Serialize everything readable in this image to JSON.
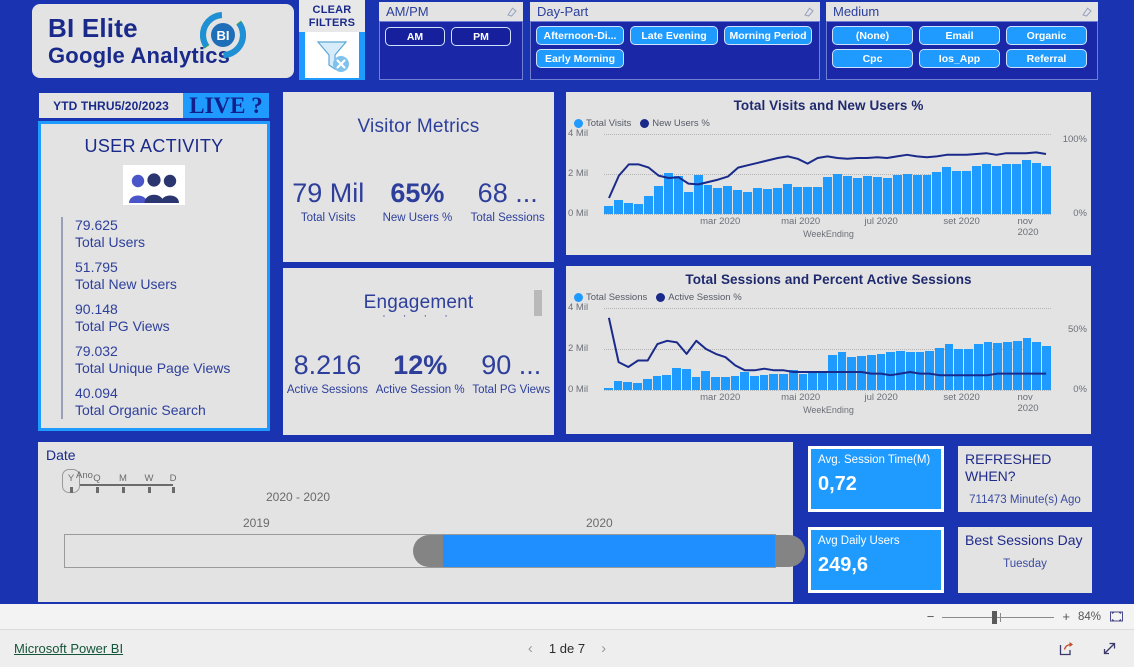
{
  "brand": {
    "line1": "BI Elite",
    "line2": "Google Analytics",
    "logo_text": "BI"
  },
  "header": {
    "clear_filters": {
      "line1": "CLEAR",
      "line2": "FILTERS",
      "icon": "funnel-clear-icon"
    },
    "slicers": [
      {
        "title": "AM/PM",
        "eraser_icon": "eraser-icon",
        "chips": [
          {
            "label": "AM",
            "style": "dark"
          },
          {
            "label": "PM",
            "style": "dark"
          }
        ]
      },
      {
        "title": "Day-Part",
        "eraser_icon": "eraser-icon",
        "chips": [
          {
            "label": "Afternoon-Di...",
            "style": "light"
          },
          {
            "label": "Late Evening",
            "style": "light"
          },
          {
            "label": "Morning Period",
            "style": "light"
          },
          {
            "label": "Early Morning",
            "style": "light"
          }
        ]
      },
      {
        "title": "Medium",
        "eraser_icon": "eraser-icon",
        "chips": [
          {
            "label": "(None)",
            "style": "light"
          },
          {
            "label": "Email",
            "style": "light"
          },
          {
            "label": "Organic",
            "style": "light"
          },
          {
            "label": "Cpc",
            "style": "light"
          },
          {
            "label": "Ios_App",
            "style": "light"
          },
          {
            "label": "Referral",
            "style": "light"
          }
        ]
      }
    ]
  },
  "ytd": {
    "label": "YTD THRU5/20/2023",
    "live": "LIVE ?"
  },
  "user_activity": {
    "title": "USER ACTIVITY",
    "icon": "people-group-icon",
    "metrics": [
      {
        "value": "79.625",
        "label": "Total Users"
      },
      {
        "value": "51.795",
        "label": "Total New Users"
      },
      {
        "value": "90.148",
        "label": "Total PG Views"
      },
      {
        "value": "79.032",
        "label": "Total Unique Page Views"
      },
      {
        "value": "40.094",
        "label": "Total Organic Search"
      }
    ]
  },
  "visitor_metrics": {
    "title": "Visitor Metrics",
    "items": [
      {
        "value": "79 Mil",
        "label": "Total Visits",
        "bold": false
      },
      {
        "value": "65%",
        "label": "New Users %",
        "bold": true
      },
      {
        "value": "68 ...",
        "label": "Total Sessions",
        "bold": false
      }
    ]
  },
  "engagement": {
    "title": "Engagement",
    "dots": "· · · ·",
    "items": [
      {
        "value": "8.216",
        "label": "Active Sessions",
        "bold": false
      },
      {
        "value": "12%",
        "label": "Active Session %",
        "bold": true
      },
      {
        "value": "90 ...",
        "label": "Total PG Views",
        "bold": false
      }
    ]
  },
  "date_panel": {
    "title": "Date",
    "granularity": {
      "nodes": [
        "Y",
        "Q",
        "M",
        "W",
        "D"
      ],
      "selected": "Y",
      "caption": "Ano"
    },
    "range_text": "2020 - 2020",
    "slider_left_year": "2019",
    "slider_right_year": "2020"
  },
  "mini_cards": [
    {
      "name": "avg-session-time",
      "title": "Avg. Session Time(M)",
      "value": "0,72",
      "style": "blue"
    },
    {
      "name": "refreshed-when",
      "title": "REFRESHED WHEN?",
      "value": "711473 Minute(s) Ago",
      "style": "grey"
    },
    {
      "name": "avg-daily-users",
      "title": "Avg Daily Users",
      "value": "249,6",
      "style": "blue"
    },
    {
      "name": "best-sessions-day",
      "title": "Best Sessions Day",
      "value": "Tuesday",
      "style": "grey"
    }
  ],
  "status_bar": {
    "zoom_minus": "−",
    "zoom_plus": "+",
    "zoom_pct": "84%",
    "fit_icon": "fit-to-page-icon"
  },
  "footer": {
    "brand": "Microsoft Power BI",
    "prev_icon": "chevron-left-icon",
    "page_text": "1 de 7",
    "next_icon": "chevron-right-icon",
    "share_icon": "share-icon",
    "fullscreen_icon": "fullscreen-icon"
  },
  "colors": {
    "canvas_blue": "#1a33b0",
    "accent_blue": "#1f9bff",
    "dark_navy": "#16209c",
    "card_grey": "#e3e3e3",
    "text_navy": "#2d3f9b"
  },
  "chart_data": [
    {
      "type": "bar",
      "title": "Total Visits and New Users %",
      "xlabel": "WeekEnding",
      "ylabel": "",
      "legend": [
        {
          "name": "Total Visits",
          "color": "#1f9bff",
          "kind": "bar"
        },
        {
          "name": "New Users %",
          "color": "#1a2a8a",
          "kind": "line"
        }
      ],
      "legend_position": "top-left",
      "grid": true,
      "y_left_ticks": [
        "0 Mil",
        "2 Mil",
        "4 Mil"
      ],
      "ylim": [
        0,
        4
      ],
      "y_right_ticks": [
        "0%",
        "100%"
      ],
      "y2lim": [
        0,
        100
      ],
      "x_ticks": [
        "mar 2020",
        "mai 2020",
        "jul 2020",
        "set 2020",
        "nov 2020"
      ],
      "x_tick_positions_pct": [
        26,
        44,
        62,
        80,
        95
      ],
      "series": [
        {
          "name": "Total Visits",
          "kind": "bar",
          "values": [
            0.42,
            0.72,
            0.55,
            0.48,
            0.88,
            1.38,
            2.05,
            1.92,
            1.1,
            1.93,
            1.45,
            1.32,
            1.4,
            1.22,
            1.12,
            1.28,
            1.27,
            1.28,
            1.5,
            1.36,
            1.34,
            1.35,
            1.86,
            2.0,
            1.89,
            1.78,
            1.88,
            1.83,
            1.82,
            1.93,
            2.0,
            1.95,
            1.97,
            2.12,
            2.33,
            2.16,
            2.16,
            2.42,
            2.48,
            2.4,
            2.5,
            2.48,
            2.72,
            2.56,
            2.38
          ]
        },
        {
          "name": "New Users %",
          "kind": "line",
          "values": [
            20,
            48,
            62,
            62,
            58,
            48,
            45,
            46,
            38,
            37,
            40,
            43,
            47,
            58,
            61,
            64,
            67,
            70,
            72,
            69,
            63,
            70,
            72,
            70,
            69,
            70,
            70,
            71,
            70,
            72,
            74,
            72,
            71,
            72,
            74,
            74,
            74,
            75,
            76,
            74,
            76,
            76,
            76,
            77,
            75
          ]
        }
      ]
    },
    {
      "type": "bar",
      "title": "Total Sessions and Percent Active Sessions",
      "xlabel": "WeekEnding",
      "ylabel": "",
      "legend": [
        {
          "name": "Total Sessions",
          "color": "#1f9bff",
          "kind": "bar"
        },
        {
          "name": "Active Session %",
          "color": "#1a2a8a",
          "kind": "line"
        }
      ],
      "legend_position": "top-left",
      "grid": true,
      "y_left_ticks": [
        "0 Mil",
        "2 Mil",
        "4 Mil"
      ],
      "ylim": [
        0,
        4
      ],
      "y_right_ticks": [
        "0%",
        "50%"
      ],
      "y2lim": [
        0,
        50
      ],
      "x_ticks": [
        "mar 2020",
        "mai 2020",
        "jul 2020",
        "set 2020",
        "nov 2020"
      ],
      "x_tick_positions_pct": [
        26,
        44,
        62,
        80,
        95
      ],
      "series": [
        {
          "name": "Total Sessions",
          "kind": "bar",
          "values": [
            0.08,
            0.45,
            0.38,
            0.34,
            0.52,
            0.66,
            0.74,
            1.06,
            1.04,
            0.62,
            0.92,
            0.64,
            0.63,
            0.7,
            0.88,
            0.7,
            0.72,
            0.76,
            0.76,
            0.96,
            0.8,
            0.86,
            0.92,
            1.72,
            1.86,
            1.62,
            1.66,
            1.72,
            1.74,
            1.84,
            1.88,
            1.86,
            1.84,
            1.9,
            2.04,
            2.24,
            1.98,
            2.0,
            2.24,
            2.32,
            2.28,
            2.32,
            2.4,
            2.56,
            2.34,
            2.16
          ]
        },
        {
          "name": "Active Session %",
          "kind": "line",
          "values": [
            44,
            17,
            14,
            18,
            18,
            28,
            30,
            29,
            22,
            30,
            25,
            22,
            20,
            15,
            12,
            12,
            13,
            12,
            12,
            11,
            11,
            11,
            11,
            11,
            11,
            11,
            11,
            10,
            10,
            9,
            10,
            11,
            10,
            10,
            9,
            9,
            9,
            9,
            9,
            9,
            10,
            10,
            10,
            10,
            10,
            10
          ]
        }
      ]
    }
  ]
}
